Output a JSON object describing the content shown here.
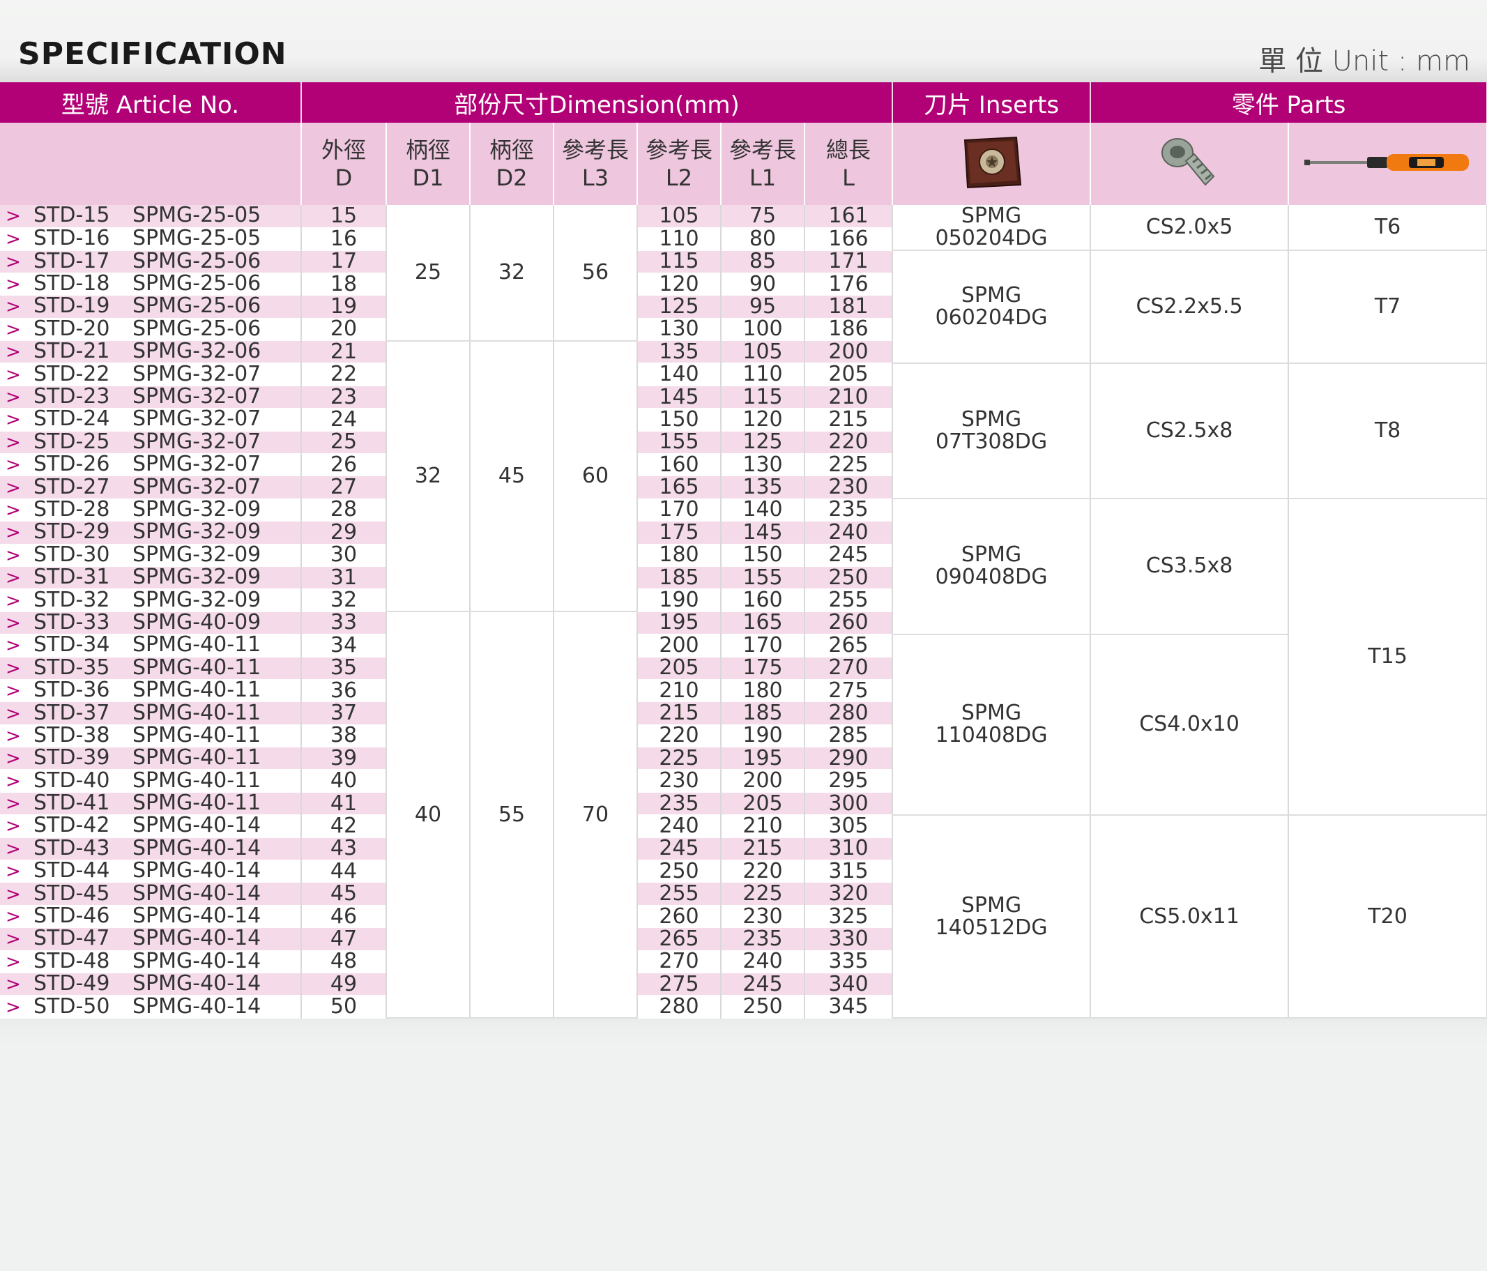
{
  "page": {
    "title": "SPECIFICATION",
    "unit_label": "單 位 Unit : mm"
  },
  "header": {
    "article": "型號 Article No.",
    "dimension": "部份尺寸Dimension(mm)",
    "inserts": "刀片 Inserts",
    "parts": "零件 Parts",
    "cols": [
      {
        "zh": "外徑",
        "en": "D"
      },
      {
        "zh": "柄徑",
        "en": "D1"
      },
      {
        "zh": "柄徑",
        "en": "D2"
      },
      {
        "zh": "參考長",
        "en": "L3"
      },
      {
        "zh": "參考長",
        "en": "L2"
      },
      {
        "zh": "參考長",
        "en": "L1"
      },
      {
        "zh": "總長",
        "en": "L"
      }
    ],
    "icons": {
      "insert": "carbide-insert-image",
      "screw": "torx-screw-image",
      "driver": "torx-screwdriver-image"
    },
    "colors": {
      "header": "#b20076",
      "subheader": "#eeb6d8",
      "stripe": "#f5dbea"
    }
  },
  "rows": [
    {
      "std": "STD-15",
      "spmg": "SPMG-25-05",
      "d": "15",
      "l2": "105",
      "l1": "75",
      "l": "161"
    },
    {
      "std": "STD-16",
      "spmg": "SPMG-25-05",
      "d": "16",
      "l2": "110",
      "l1": "80",
      "l": "166"
    },
    {
      "std": "STD-17",
      "spmg": "SPMG-25-06",
      "d": "17",
      "l2": "115",
      "l1": "85",
      "l": "171"
    },
    {
      "std": "STD-18",
      "spmg": "SPMG-25-06",
      "d": "18",
      "l2": "120",
      "l1": "90",
      "l": "176"
    },
    {
      "std": "STD-19",
      "spmg": "SPMG-25-06",
      "d": "19",
      "l2": "125",
      "l1": "95",
      "l": "181"
    },
    {
      "std": "STD-20",
      "spmg": "SPMG-25-06",
      "d": "20",
      "l2": "130",
      "l1": "100",
      "l": "186"
    },
    {
      "std": "STD-21",
      "spmg": "SPMG-32-06",
      "d": "21",
      "l2": "135",
      "l1": "105",
      "l": "200"
    },
    {
      "std": "STD-22",
      "spmg": "SPMG-32-07",
      "d": "22",
      "l2": "140",
      "l1": "110",
      "l": "205"
    },
    {
      "std": "STD-23",
      "spmg": "SPMG-32-07",
      "d": "23",
      "l2": "145",
      "l1": "115",
      "l": "210"
    },
    {
      "std": "STD-24",
      "spmg": "SPMG-32-07",
      "d": "24",
      "l2": "150",
      "l1": "120",
      "l": "215"
    },
    {
      "std": "STD-25",
      "spmg": "SPMG-32-07",
      "d": "25",
      "l2": "155",
      "l1": "125",
      "l": "220"
    },
    {
      "std": "STD-26",
      "spmg": "SPMG-32-07",
      "d": "26",
      "l2": "160",
      "l1": "130",
      "l": "225"
    },
    {
      "std": "STD-27",
      "spmg": "SPMG-32-07",
      "d": "27",
      "l2": "165",
      "l1": "135",
      "l": "230"
    },
    {
      "std": "STD-28",
      "spmg": "SPMG-32-09",
      "d": "28",
      "l2": "170",
      "l1": "140",
      "l": "235"
    },
    {
      "std": "STD-29",
      "spmg": "SPMG-32-09",
      "d": "29",
      "l2": "175",
      "l1": "145",
      "l": "240"
    },
    {
      "std": "STD-30",
      "spmg": "SPMG-32-09",
      "d": "30",
      "l2": "180",
      "l1": "150",
      "l": "245"
    },
    {
      "std": "STD-31",
      "spmg": "SPMG-32-09",
      "d": "31",
      "l2": "185",
      "l1": "155",
      "l": "250"
    },
    {
      "std": "STD-32",
      "spmg": "SPMG-32-09",
      "d": "32",
      "l2": "190",
      "l1": "160",
      "l": "255"
    },
    {
      "std": "STD-33",
      "spmg": "SPMG-40-09",
      "d": "33",
      "l2": "195",
      "l1": "165",
      "l": "260"
    },
    {
      "std": "STD-34",
      "spmg": "SPMG-40-11",
      "d": "34",
      "l2": "200",
      "l1": "170",
      "l": "265"
    },
    {
      "std": "STD-35",
      "spmg": "SPMG-40-11",
      "d": "35",
      "l2": "205",
      "l1": "175",
      "l": "270"
    },
    {
      "std": "STD-36",
      "spmg": "SPMG-40-11",
      "d": "36",
      "l2": "210",
      "l1": "180",
      "l": "275"
    },
    {
      "std": "STD-37",
      "spmg": "SPMG-40-11",
      "d": "37",
      "l2": "215",
      "l1": "185",
      "l": "280"
    },
    {
      "std": "STD-38",
      "spmg": "SPMG-40-11",
      "d": "38",
      "l2": "220",
      "l1": "190",
      "l": "285"
    },
    {
      "std": "STD-39",
      "spmg": "SPMG-40-11",
      "d": "39",
      "l2": "225",
      "l1": "195",
      "l": "290"
    },
    {
      "std": "STD-40",
      "spmg": "SPMG-40-11",
      "d": "40",
      "l2": "230",
      "l1": "200",
      "l": "295"
    },
    {
      "std": "STD-41",
      "spmg": "SPMG-40-11",
      "d": "41",
      "l2": "235",
      "l1": "205",
      "l": "300"
    },
    {
      "std": "STD-42",
      "spmg": "SPMG-40-14",
      "d": "42",
      "l2": "240",
      "l1": "210",
      "l": "305"
    },
    {
      "std": "STD-43",
      "spmg": "SPMG-40-14",
      "d": "43",
      "l2": "245",
      "l1": "215",
      "l": "310"
    },
    {
      "std": "STD-44",
      "spmg": "SPMG-40-14",
      "d": "44",
      "l2": "250",
      "l1": "220",
      "l": "315"
    },
    {
      "std": "STD-45",
      "spmg": "SPMG-40-14",
      "d": "45",
      "l2": "255",
      "l1": "225",
      "l": "320"
    },
    {
      "std": "STD-46",
      "spmg": "SPMG-40-14",
      "d": "46",
      "l2": "260",
      "l1": "230",
      "l": "325"
    },
    {
      "std": "STD-47",
      "spmg": "SPMG-40-14",
      "d": "47",
      "l2": "265",
      "l1": "235",
      "l": "330"
    },
    {
      "std": "STD-48",
      "spmg": "SPMG-40-14",
      "d": "48",
      "l2": "270",
      "l1": "240",
      "l": "335"
    },
    {
      "std": "STD-49",
      "spmg": "SPMG-40-14",
      "d": "49",
      "l2": "275",
      "l1": "245",
      "l": "340"
    },
    {
      "std": "STD-50",
      "spmg": "SPMG-40-14",
      "d": "50",
      "l2": "280",
      "l1": "250",
      "l": "345"
    }
  ],
  "shank_groups": [
    {
      "start": 0,
      "span": 6,
      "d1": "25",
      "d2": "32",
      "l3": "56"
    },
    {
      "start": 6,
      "span": 12,
      "d1": "32",
      "d2": "45",
      "l3": "60"
    },
    {
      "start": 18,
      "span": 18,
      "d1": "40",
      "d2": "55",
      "l3": "70"
    }
  ],
  "insert_groups": [
    {
      "start": 0,
      "span": 2,
      "line1": "SPMG",
      "line2": "050204DG",
      "screw": "CS2.0x5"
    },
    {
      "start": 2,
      "span": 5,
      "line1": "SPMG",
      "line2": "060204DG",
      "screw": "CS2.2x5.5"
    },
    {
      "start": 7,
      "span": 6,
      "line1": "SPMG",
      "line2": "07T308DG",
      "screw": "CS2.5x8"
    },
    {
      "start": 13,
      "span": 6,
      "line1": "SPMG",
      "line2": "090408DG",
      "screw": "CS3.5x8"
    },
    {
      "start": 19,
      "span": 8,
      "line1": "SPMG",
      "line2": "110408DG",
      "screw": "CS4.0x10"
    },
    {
      "start": 27,
      "span": 9,
      "line1": "SPMG",
      "line2": "140512DG",
      "screw": "CS5.0x11"
    }
  ],
  "driver_groups": [
    {
      "start": 0,
      "span": 2,
      "label": "T6"
    },
    {
      "start": 2,
      "span": 5,
      "label": "T7"
    },
    {
      "start": 7,
      "span": 6,
      "label": "T8"
    },
    {
      "start": 13,
      "span": 14,
      "label": "T15"
    },
    {
      "start": 27,
      "span": 9,
      "label": "T20"
    }
  ]
}
